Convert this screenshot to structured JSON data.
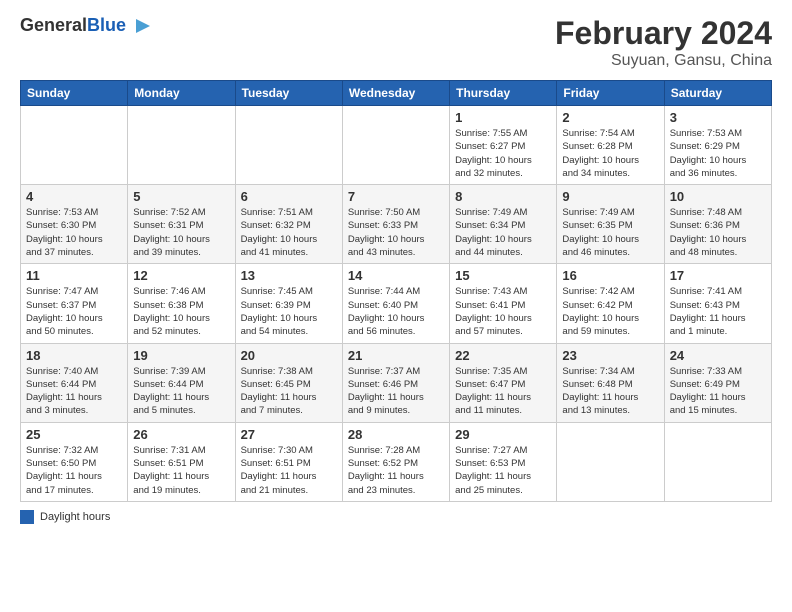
{
  "header": {
    "logo_general": "General",
    "logo_blue": "Blue",
    "main_title": "February 2024",
    "sub_title": "Suyuan, Gansu, China"
  },
  "calendar": {
    "days_of_week": [
      "Sunday",
      "Monday",
      "Tuesday",
      "Wednesday",
      "Thursday",
      "Friday",
      "Saturday"
    ],
    "weeks": [
      [
        {
          "day": "",
          "info": ""
        },
        {
          "day": "",
          "info": ""
        },
        {
          "day": "",
          "info": ""
        },
        {
          "day": "",
          "info": ""
        },
        {
          "day": "1",
          "info": "Sunrise: 7:55 AM\nSunset: 6:27 PM\nDaylight: 10 hours\nand 32 minutes."
        },
        {
          "day": "2",
          "info": "Sunrise: 7:54 AM\nSunset: 6:28 PM\nDaylight: 10 hours\nand 34 minutes."
        },
        {
          "day": "3",
          "info": "Sunrise: 7:53 AM\nSunset: 6:29 PM\nDaylight: 10 hours\nand 36 minutes."
        }
      ],
      [
        {
          "day": "4",
          "info": "Sunrise: 7:53 AM\nSunset: 6:30 PM\nDaylight: 10 hours\nand 37 minutes."
        },
        {
          "day": "5",
          "info": "Sunrise: 7:52 AM\nSunset: 6:31 PM\nDaylight: 10 hours\nand 39 minutes."
        },
        {
          "day": "6",
          "info": "Sunrise: 7:51 AM\nSunset: 6:32 PM\nDaylight: 10 hours\nand 41 minutes."
        },
        {
          "day": "7",
          "info": "Sunrise: 7:50 AM\nSunset: 6:33 PM\nDaylight: 10 hours\nand 43 minutes."
        },
        {
          "day": "8",
          "info": "Sunrise: 7:49 AM\nSunset: 6:34 PM\nDaylight: 10 hours\nand 44 minutes."
        },
        {
          "day": "9",
          "info": "Sunrise: 7:49 AM\nSunset: 6:35 PM\nDaylight: 10 hours\nand 46 minutes."
        },
        {
          "day": "10",
          "info": "Sunrise: 7:48 AM\nSunset: 6:36 PM\nDaylight: 10 hours\nand 48 minutes."
        }
      ],
      [
        {
          "day": "11",
          "info": "Sunrise: 7:47 AM\nSunset: 6:37 PM\nDaylight: 10 hours\nand 50 minutes."
        },
        {
          "day": "12",
          "info": "Sunrise: 7:46 AM\nSunset: 6:38 PM\nDaylight: 10 hours\nand 52 minutes."
        },
        {
          "day": "13",
          "info": "Sunrise: 7:45 AM\nSunset: 6:39 PM\nDaylight: 10 hours\nand 54 minutes."
        },
        {
          "day": "14",
          "info": "Sunrise: 7:44 AM\nSunset: 6:40 PM\nDaylight: 10 hours\nand 56 minutes."
        },
        {
          "day": "15",
          "info": "Sunrise: 7:43 AM\nSunset: 6:41 PM\nDaylight: 10 hours\nand 57 minutes."
        },
        {
          "day": "16",
          "info": "Sunrise: 7:42 AM\nSunset: 6:42 PM\nDaylight: 10 hours\nand 59 minutes."
        },
        {
          "day": "17",
          "info": "Sunrise: 7:41 AM\nSunset: 6:43 PM\nDaylight: 11 hours\nand 1 minute."
        }
      ],
      [
        {
          "day": "18",
          "info": "Sunrise: 7:40 AM\nSunset: 6:44 PM\nDaylight: 11 hours\nand 3 minutes."
        },
        {
          "day": "19",
          "info": "Sunrise: 7:39 AM\nSunset: 6:44 PM\nDaylight: 11 hours\nand 5 minutes."
        },
        {
          "day": "20",
          "info": "Sunrise: 7:38 AM\nSunset: 6:45 PM\nDaylight: 11 hours\nand 7 minutes."
        },
        {
          "day": "21",
          "info": "Sunrise: 7:37 AM\nSunset: 6:46 PM\nDaylight: 11 hours\nand 9 minutes."
        },
        {
          "day": "22",
          "info": "Sunrise: 7:35 AM\nSunset: 6:47 PM\nDaylight: 11 hours\nand 11 minutes."
        },
        {
          "day": "23",
          "info": "Sunrise: 7:34 AM\nSunset: 6:48 PM\nDaylight: 11 hours\nand 13 minutes."
        },
        {
          "day": "24",
          "info": "Sunrise: 7:33 AM\nSunset: 6:49 PM\nDaylight: 11 hours\nand 15 minutes."
        }
      ],
      [
        {
          "day": "25",
          "info": "Sunrise: 7:32 AM\nSunset: 6:50 PM\nDaylight: 11 hours\nand 17 minutes."
        },
        {
          "day": "26",
          "info": "Sunrise: 7:31 AM\nSunset: 6:51 PM\nDaylight: 11 hours\nand 19 minutes."
        },
        {
          "day": "27",
          "info": "Sunrise: 7:30 AM\nSunset: 6:51 PM\nDaylight: 11 hours\nand 21 minutes."
        },
        {
          "day": "28",
          "info": "Sunrise: 7:28 AM\nSunset: 6:52 PM\nDaylight: 11 hours\nand 23 minutes."
        },
        {
          "day": "29",
          "info": "Sunrise: 7:27 AM\nSunset: 6:53 PM\nDaylight: 11 hours\nand 25 minutes."
        },
        {
          "day": "",
          "info": ""
        },
        {
          "day": "",
          "info": ""
        }
      ]
    ]
  },
  "legend": {
    "label": "Daylight hours"
  }
}
